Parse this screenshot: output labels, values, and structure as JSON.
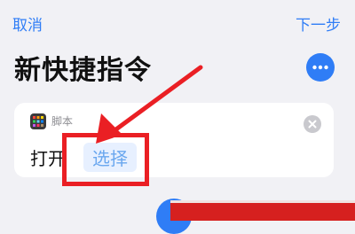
{
  "nav": {
    "cancel_label": "取消",
    "next_label": "下一步"
  },
  "page": {
    "title": "新快捷指令"
  },
  "action_card": {
    "app_name": "脚本",
    "action_label": "打开",
    "parameter_label": "选择"
  },
  "icons": {
    "more": "more-icon",
    "app": "scripting-app-icon",
    "remove": "close-icon"
  },
  "colors": {
    "accent": "#2f7df6",
    "highlight": "#ea1f24",
    "background": "#f1f1f5"
  }
}
